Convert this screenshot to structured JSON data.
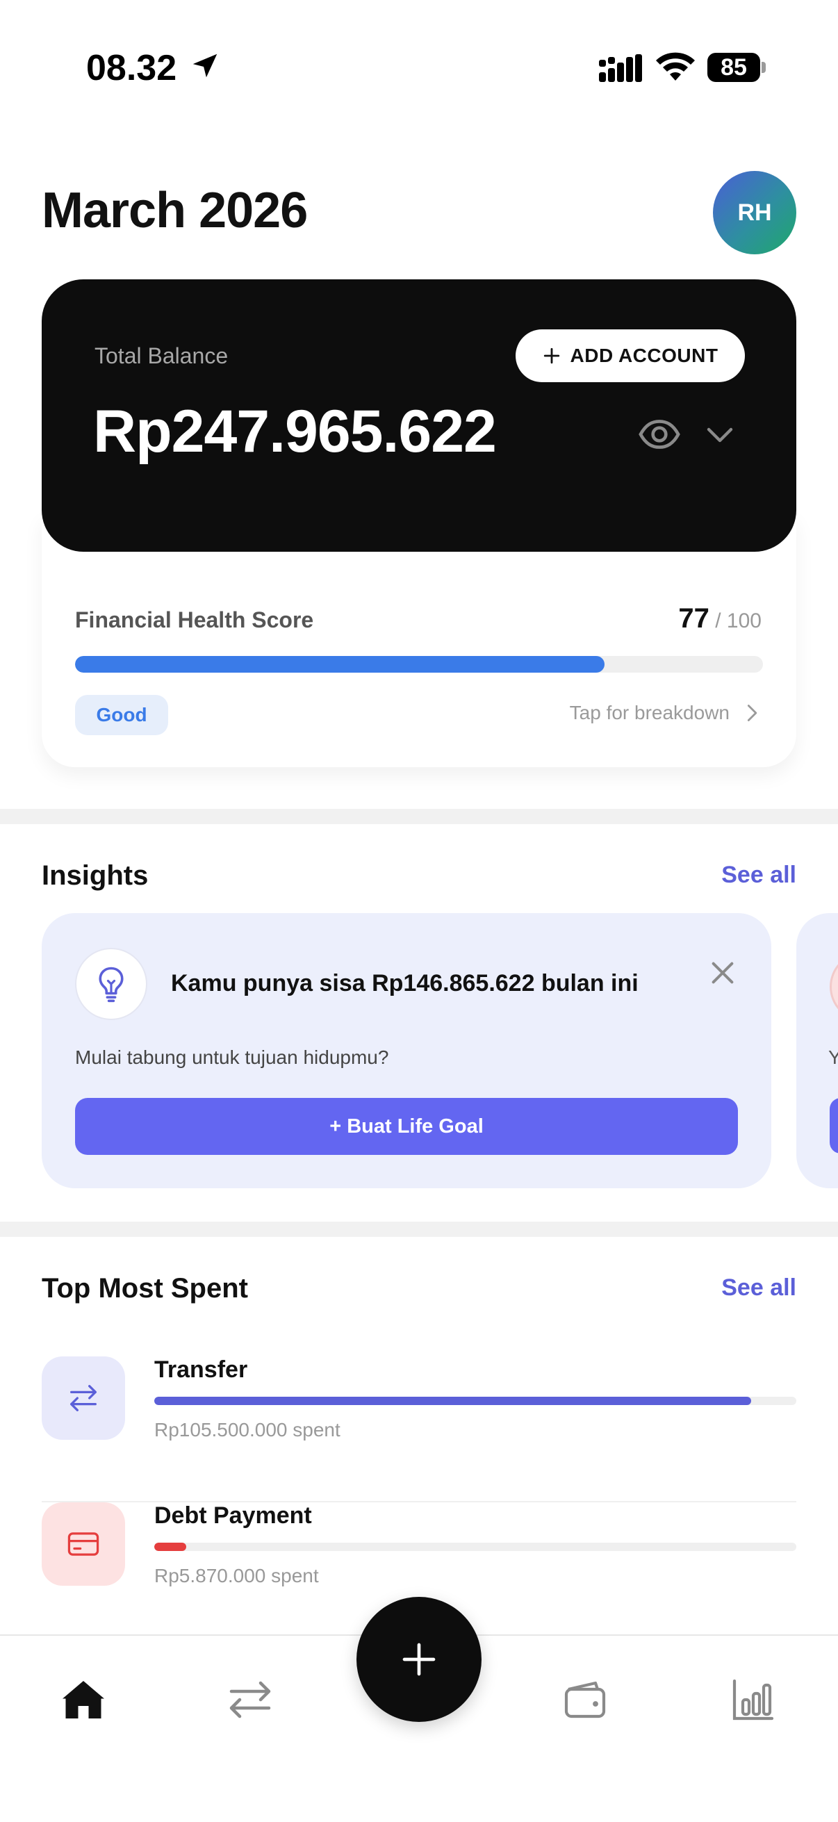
{
  "status_bar": {
    "time": "08.32",
    "battery": "85"
  },
  "header": {
    "title": "March 2026",
    "avatar_initials": "RH"
  },
  "balance": {
    "label": "Total Balance",
    "amount": "Rp247.965.622",
    "add_account_label": "ADD ACCOUNT"
  },
  "health": {
    "label": "Financial Health Score",
    "score": "77",
    "max": "/ 100",
    "progress_fraction": 0.77,
    "status": "Good",
    "breakdown_label": "Tap for breakdown",
    "color": "#3a7be8"
  },
  "insights": {
    "title": "Insights",
    "see_all": "See all",
    "card": {
      "title": "Kamu punya sisa Rp146.865.622 bulan ini",
      "subtitle": "Mulai tabung untuk tujuan hidupmu?",
      "button_label": "+ Buat Life Goal",
      "icon": "lightbulb-icon"
    },
    "next_card_peek": "Y"
  },
  "top_spent": {
    "title": "Top Most Spent",
    "see_all": "See all",
    "items": [
      {
        "name": "Transfer",
        "amount": "Rp105.500.000 spent",
        "fraction": 0.93,
        "color": "#5b5fd8",
        "bg": "#e8e9fb",
        "icon": "transfer-icon"
      },
      {
        "name": "Debt Payment",
        "amount": "Rp5.870.000 spent",
        "fraction": 0.05,
        "color": "#e53e3e",
        "bg": "#fde2e2",
        "icon": "credit-card-icon"
      }
    ]
  },
  "bottom_nav": {
    "items": [
      "home-icon",
      "transfer-icon",
      "add-icon",
      "wallet-icon",
      "chart-icon"
    ]
  },
  "colors": {
    "accent": "#6366f1",
    "link": "#5b5fd8"
  }
}
